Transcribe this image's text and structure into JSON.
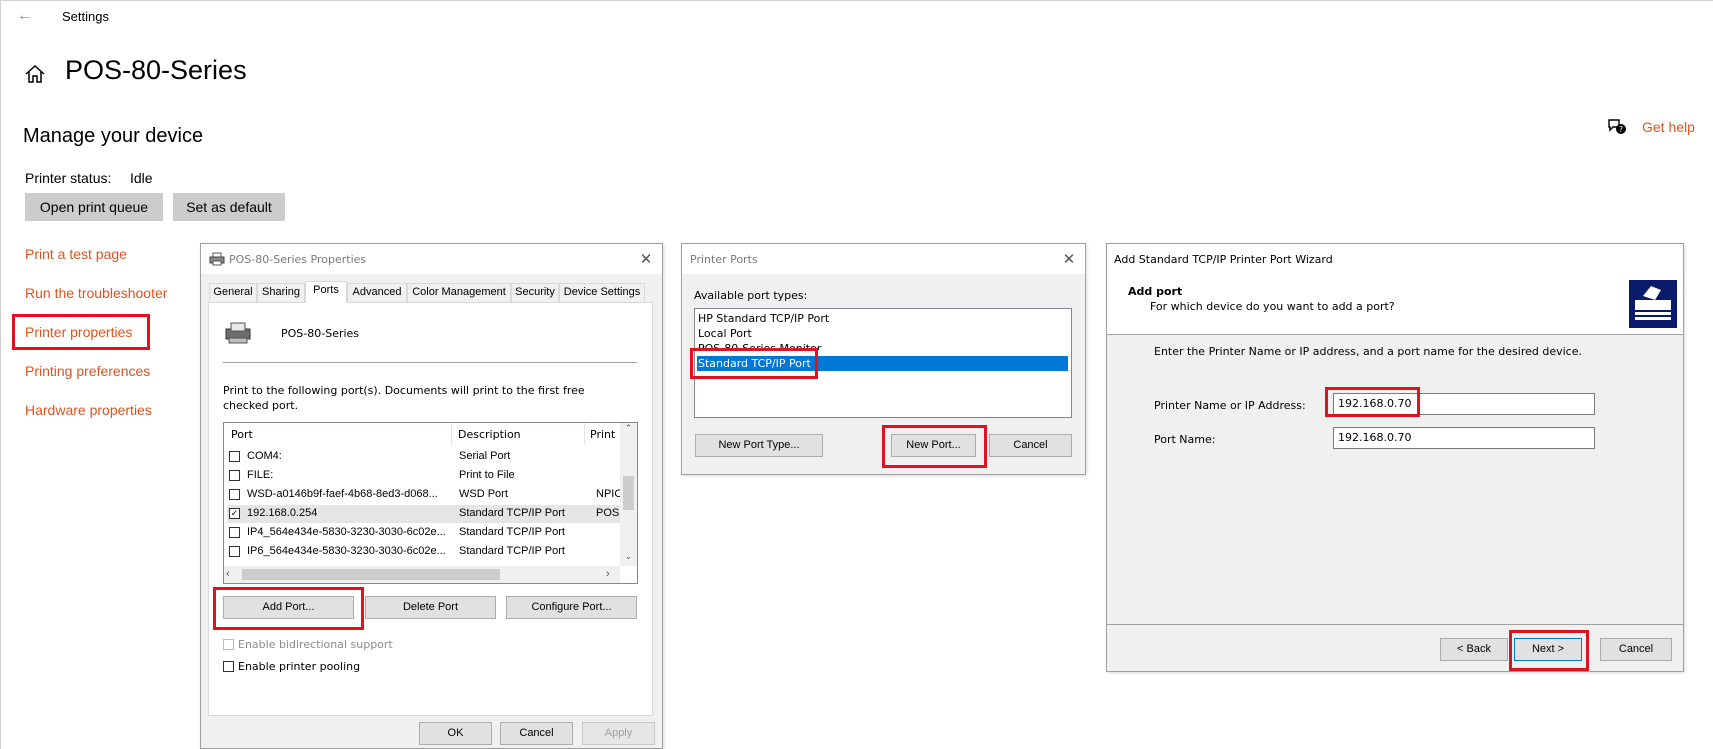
{
  "settings": {
    "app_title": "Settings",
    "device_name": "POS-80-Series",
    "manage_title": "Manage your device",
    "status_label": "Printer status:",
    "status_value": "Idle",
    "open_queue": "Open print queue",
    "set_default": "Set as default",
    "links": [
      "Print a test page",
      "Run the troubleshooter",
      "Printer properties",
      "Printing preferences",
      "Hardware properties"
    ],
    "get_help": "Get help",
    "accent_color": "#e0521f"
  },
  "properties": {
    "title": "POS-80-Series Properties",
    "tabs": [
      "General",
      "Sharing",
      "Ports",
      "Advanced",
      "Color Management",
      "Security",
      "Device Settings"
    ],
    "printer_name": "POS-80-Series",
    "instructions": "Print to the following port(s). Documents will print to the first free checked port.",
    "columns": [
      "Port",
      "Description",
      "Print"
    ],
    "rows": [
      {
        "port": "COM4:",
        "description": "Serial Port",
        "printer": "",
        "checked": false
      },
      {
        "port": "FILE:",
        "description": "Print to File",
        "printer": "",
        "checked": false
      },
      {
        "port": "WSD-a0146b9f-faef-4b68-8ed3-d068...",
        "description": "WSD Port",
        "printer": "NPIC",
        "checked": false
      },
      {
        "port": "192.168.0.254",
        "description": "Standard TCP/IP Port",
        "printer": "POS",
        "checked": true
      },
      {
        "port": "IP4_564e434e-5830-3230-3030-6c02e...",
        "description": "Standard TCP/IP Port",
        "printer": "",
        "checked": false
      },
      {
        "port": "IP6_564e434e-5830-3230-3030-6c02e...",
        "description": "Standard TCP/IP Port",
        "printer": "",
        "checked": false
      }
    ],
    "add_port": "Add Port...",
    "delete_port": "Delete Port",
    "configure_port": "Configure Port...",
    "bidirectional": "Enable bidirectional support",
    "pooling": "Enable printer pooling",
    "ok": "OK",
    "cancel": "Cancel",
    "apply": "Apply"
  },
  "printer_ports": {
    "title": "Printer Ports",
    "available_label": "Available port types:",
    "types": [
      "HP Standard TCP/IP Port",
      "Local Port",
      "POS-80-Series Monitor",
      "Standard TCP/IP Port"
    ],
    "selected_index": 3,
    "new_port_type": "New Port Type...",
    "new_port": "New Port...",
    "cancel": "Cancel"
  },
  "wizard": {
    "title": "Add Standard TCP/IP Printer Port Wizard",
    "heading": "Add port",
    "subheading": "For which device do you want to add a port?",
    "instructions": "Enter the Printer Name or IP address, and a port name for the desired device.",
    "ip_label": "Printer Name or IP Address:",
    "ip_value": "192.168.0.70",
    "port_label": "Port Name:",
    "port_value": "192.168.0.70",
    "back": "< Back",
    "next": "Next >",
    "cancel": "Cancel"
  }
}
